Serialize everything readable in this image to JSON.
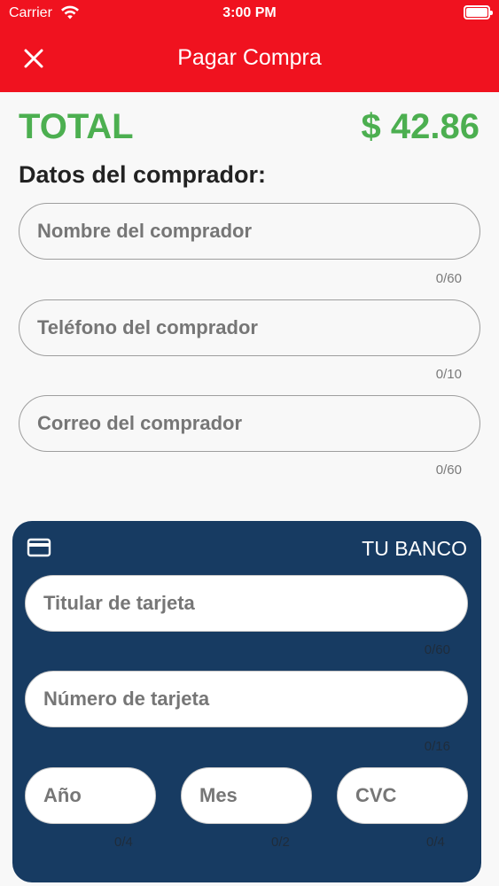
{
  "status_bar": {
    "carrier": "Carrier",
    "time": "3:00 PM"
  },
  "header": {
    "title": "Pagar Compra",
    "close_icon": "close-icon"
  },
  "total": {
    "label": "TOTAL",
    "amount": "$ 42.86"
  },
  "buyer": {
    "section_title": "Datos del comprador:",
    "name": {
      "placeholder": "Nombre del comprador",
      "counter": "0/60"
    },
    "phone": {
      "placeholder": "Teléfono del comprador",
      "counter": "0/10"
    },
    "email": {
      "placeholder": "Correo del comprador",
      "counter": "0/60"
    }
  },
  "card": {
    "icon": "credit-card-icon",
    "bank": "TU BANCO",
    "holder": {
      "placeholder": "Titular de tarjeta",
      "counter": "0/60"
    },
    "number": {
      "placeholder": "Número de tarjeta",
      "counter": "0/16"
    },
    "year": {
      "placeholder": "Año",
      "counter": "0/4"
    },
    "month": {
      "placeholder": "Mes",
      "counter": "0/2"
    },
    "cvc": {
      "placeholder": "CVC",
      "counter": "0/4"
    }
  },
  "colors": {
    "header": "#f0121f",
    "total": "#4caf50",
    "card": "#173b62"
  }
}
